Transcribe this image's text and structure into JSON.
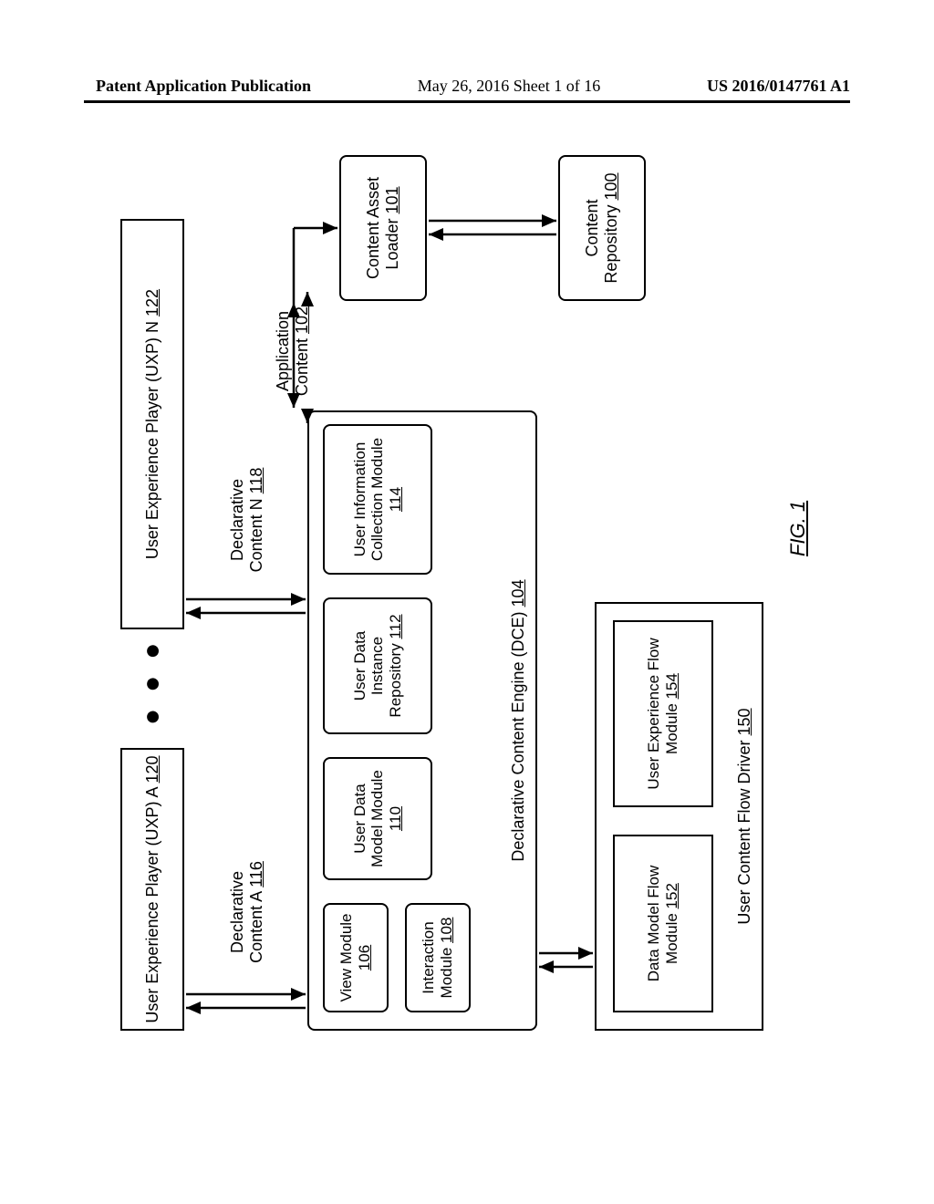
{
  "header": {
    "left": "Patent Application Publication",
    "center": "May 26, 2016  Sheet 1 of 16",
    "right": "US 2016/0147761 A1"
  },
  "figure": {
    "label": "FIG. 1",
    "uxp_a": {
      "text": "User Experience Player (UXP) A",
      "ref": "120"
    },
    "uxp_n": {
      "text": "User Experience Player (UXP) N",
      "ref": "122"
    },
    "ellipsis": "●●●",
    "decl_a": {
      "l1": "Declarative",
      "l2": "Content A",
      "ref": "116"
    },
    "decl_n": {
      "l1": "Declarative",
      "l2": "Content N",
      "ref": "118"
    },
    "app_content": {
      "l1": "Application",
      "l2": "Content",
      "ref": "102"
    },
    "dce": {
      "text": "Declarative Content Engine (DCE)",
      "ref": "104"
    },
    "view_mod": {
      "text": "View Module",
      "ref": "106"
    },
    "interaction_mod": {
      "text": "Interaction Module",
      "ref": "108"
    },
    "udm_mod": {
      "text": "User Data Model Module",
      "ref": "110"
    },
    "udi_repo": {
      "text": "User Data Instance Repository",
      "ref": "112"
    },
    "uic_mod": {
      "text": "User Information Collection Module",
      "ref": "114"
    },
    "cal": {
      "text": "Content Asset Loader",
      "ref": "101"
    },
    "crepo": {
      "text": "Content Repository",
      "ref": "100"
    },
    "ucfd": {
      "text": "User Content Flow Driver",
      "ref": "150"
    },
    "dmfm": {
      "text": "Data Model Flow Module",
      "ref": "152"
    },
    "uxfm": {
      "text": "User Experience Flow Module",
      "ref": "154"
    }
  }
}
